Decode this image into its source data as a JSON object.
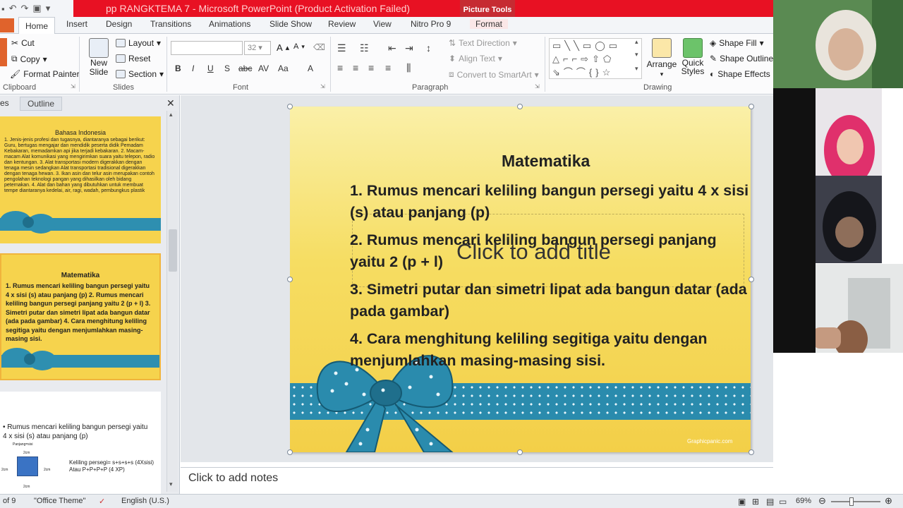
{
  "titlebar": {
    "doc_title": "pp RANGKTEMA 7 - Microsoft PowerPoint (Product Activation Failed)",
    "picture_tools": "Picture Tools"
  },
  "tabs": [
    "Home",
    "Insert",
    "Design",
    "Transitions",
    "Animations",
    "Slide Show",
    "Review",
    "View",
    "Nitro Pro 9",
    "Format"
  ],
  "ribbon": {
    "clipboard": {
      "cut": "Cut",
      "copy": "Copy",
      "format_painter": "Format Painter",
      "label": "Clipboard"
    },
    "slides": {
      "new_slide": "New Slide",
      "layout": "Layout",
      "reset": "Reset",
      "section": "Section",
      "label": "Slides"
    },
    "font": {
      "size": "32",
      "label": "Font"
    },
    "paragraph": {
      "text_direction": "Text Direction",
      "align_text": "Align Text",
      "convert_smartart": "Convert to SmartArt",
      "label": "Paragraph"
    },
    "drawing": {
      "arrange": "Arrange",
      "quick_styles": "Quick Styles",
      "shape_fill": "Shape Fill",
      "shape_outline": "Shape Outline",
      "shape_effects": "Shape Effects",
      "label": "Drawing"
    }
  },
  "panel": {
    "slides_tab": "es",
    "outline_tab": "Outline",
    "thumb1": {
      "title": "Bahasa Indonesia",
      "text": "1. Jenis-jenis profesi dan tugasnya, diantaranya sebagai berikut: Guru, bertugas mengajar dan mendidik peserta didik Pemadam Kebakaran, memadamkan api jika terjadi kebakaran. 2. Macam-macam Alat komunikasi yang mengirimkan suara yaitu telepon, radio dan kentungan. 3. Alat transportasi modern digerakkan dengan tenaga mesin sedangkan Alat transportasi tradisional digerakkan dengan tenaga hewan. 3. Ikan asin dan telur asin merupakan contoh pengolahan teknologi pangan yang dihasilkan oleh bidang peternakan. 4. Alat dan bahan yang dibutuhkan untuk membuat tempe diantaranya kedelai, air, ragi, wadah, pembungkus plastik"
    },
    "thumb2": {
      "title": "Matematika",
      "text": "1. Rumus mencari keliling bangun persegi yaitu 4 x sisi (s) atau panjang (p) 2. Rumus mencari keliling bangun persegi panjang yaitu 2 (p + l) 3. Simetri putar dan simetri lipat ada bangun datar (ada pada gambar) 4. Cara menghitung keliling segitiga yaitu dengan menjumlahkan masing-masing sisi."
    },
    "thumb3": {
      "bullet": "Rumus mencari keliling bangun persegi yaitu 4 x sisi (s) atau panjang (p)",
      "label_top": "Panjang=sisi",
      "dim_top": "2cm",
      "dim_left": "2cm",
      "dim_right": "2cm",
      "dim_bottom": "2cm",
      "formula1": "Keliling persegi= s+s+s+s (4Xsisi)",
      "formula2": "Atau P+P+P+P (4 XP)"
    }
  },
  "slide": {
    "title": "Matematika",
    "items": [
      "1. Rumus mencari keliling bangun persegi yaitu 4 x sisi (s) atau panjang (p)",
      "2. Rumus mencari keliling bangun persegi panjang yaitu 2 (p + l)",
      "3. Simetri putar dan simetri lipat ada bangun datar (ada pada gambar)",
      "4. Cara menghitung keliling segitiga yaitu dengan menjumlahkan masing-masing sisi."
    ],
    "placeholder": "Click to add title",
    "watermark": "Graphicpanic.com"
  },
  "notes": {
    "placeholder": "Click to add notes"
  },
  "status": {
    "slide_of": "of 9",
    "theme": "\"Office Theme\"",
    "language": "English (U.S.)",
    "zoom": "69%"
  },
  "colors": {
    "titlebar_red": "#e81123",
    "slide_yellow": "#f6dd62",
    "ribbon_blue": "#2a8bad"
  }
}
